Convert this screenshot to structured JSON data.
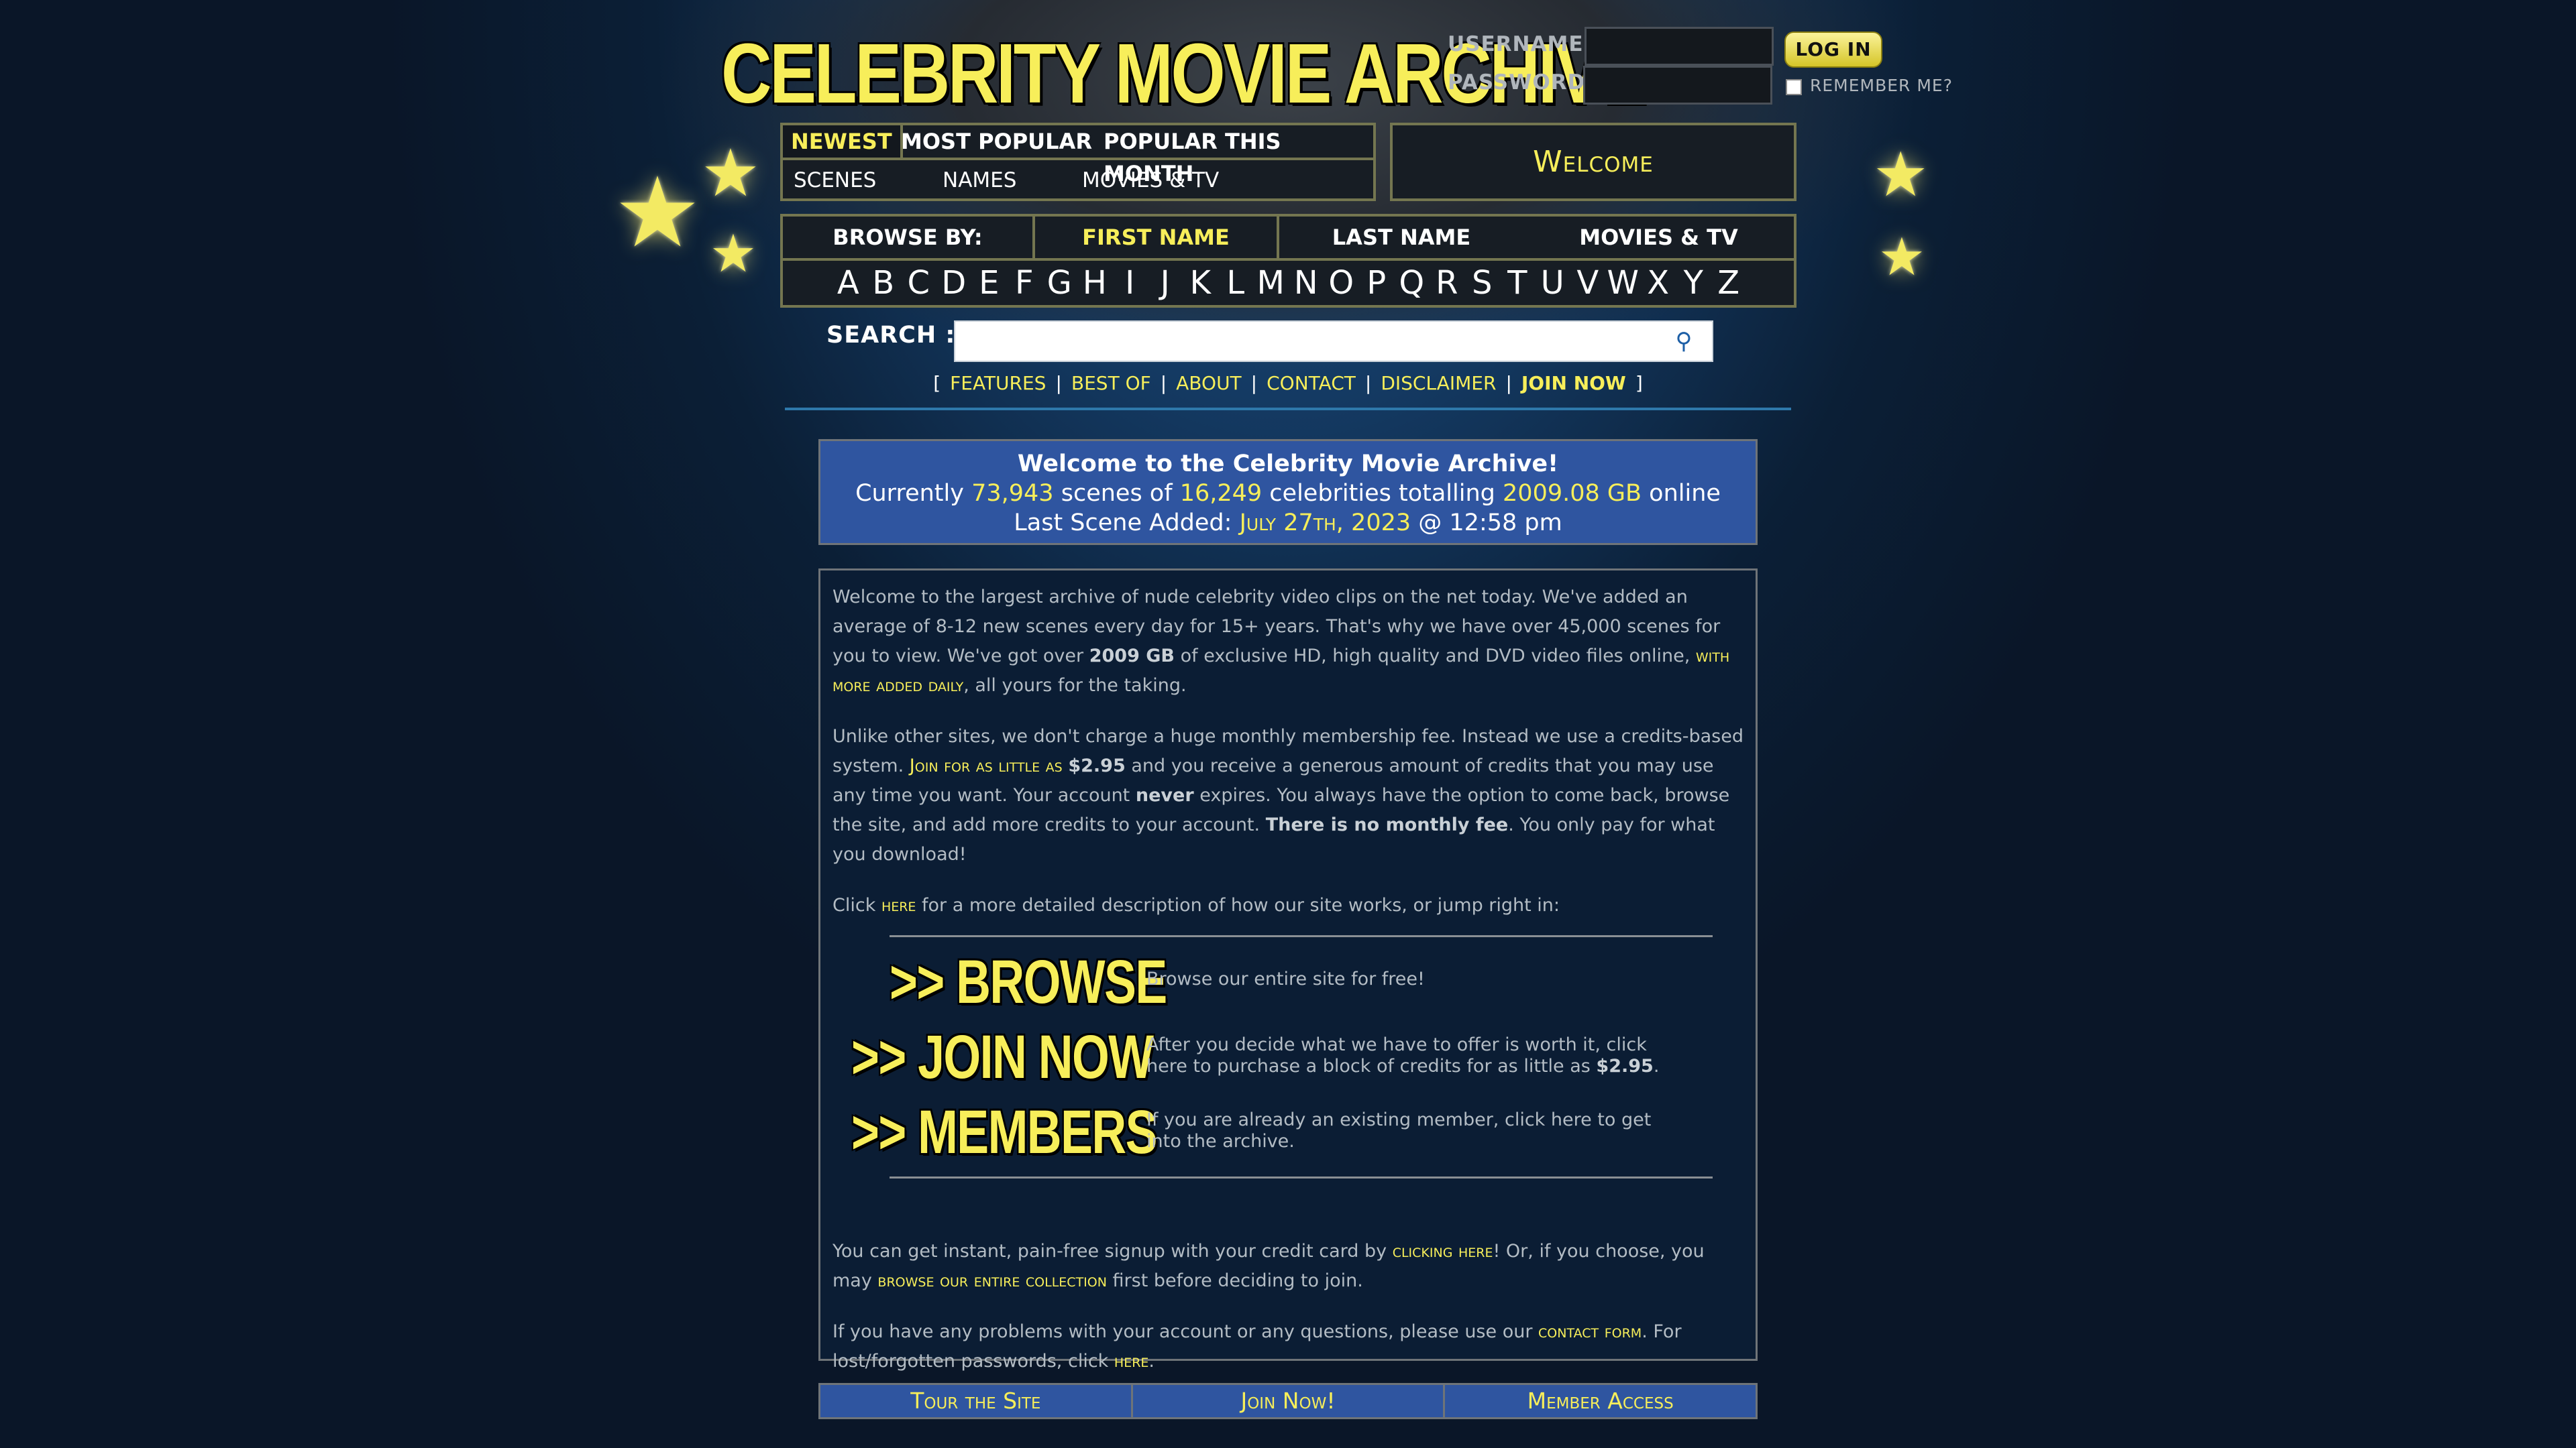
{
  "site": {
    "title": "CELEBRITY MOVIE ARCHIVE"
  },
  "login": {
    "username_label": "USERNAME:",
    "password_label": "PASSWORD:",
    "button_label": "LOG IN",
    "remember_label": "REMEMBER ME?"
  },
  "nav": {
    "tabs": [
      "NEWEST",
      "MOST POPULAR",
      "POPULAR THIS MONTH"
    ],
    "sublinks": [
      "SCENES",
      "NAMES",
      "MOVIES & TV"
    ]
  },
  "welcome": {
    "label": "Welcome"
  },
  "browse": {
    "label": "BROWSE BY:",
    "tabs": [
      "FIRST NAME",
      "LAST NAME",
      "MOVIES & TV"
    ],
    "letters": [
      "A",
      "B",
      "C",
      "D",
      "E",
      "F",
      "G",
      "H",
      "I",
      "J",
      "K",
      "L",
      "M",
      "N",
      "O",
      "P",
      "Q",
      "R",
      "S",
      "T",
      "U",
      "V",
      "W",
      "X",
      "Y",
      "Z"
    ]
  },
  "search": {
    "label": "SEARCH :",
    "placeholder": ""
  },
  "footer_links": {
    "open": "[",
    "close": "]",
    "items": [
      "FEATURES",
      "BEST OF",
      "ABOUT",
      "CONTACT",
      "DISCLAIMER",
      "JOIN NOW"
    ]
  },
  "stats": {
    "heading": "Welcome to the Celebrity Movie Archive!",
    "l2_prefix": "Currently",
    "scenes": "73,943",
    "l2_mid1": "scenes of",
    "celebrities": "16,249",
    "l2_mid2": "celebrities totalling",
    "size": "2009.08 GB",
    "l2_suffix": "online",
    "l3_prefix": "Last Scene Added:",
    "last_date": "July 27th, 2023",
    "last_time": "@ 12:58 pm"
  },
  "content": {
    "p1_a": "Welcome to the largest archive of nude celebrity video clips on the net today. We've added an average of 8-12 new scenes every day for 15+ years. That's why we have over 45,000 scenes for you to view. We've got over",
    "p1_bold": "2009 GB",
    "p1_b": "of exclusive HD, high quality and DVD video files online,",
    "p1_link": "with more added daily",
    "p1_c": ", all yours for the taking.",
    "p2_a": "Unlike other sites, we don't charge a huge monthly membership fee. Instead we use a credits-based system.",
    "p2_link": "Join for as little as",
    "p2_price": "$2.95",
    "p2_b": "and you receive a generous amount of credits that you may use any time you want. Your account",
    "p2_never": "never",
    "p2_c": "expires. You always have the option to come back, browse the site, and add more credits to your account.",
    "p2_bold": "There is no monthly fee",
    "p2_d": ". You only pay for what you download!",
    "p3_a": "Click",
    "p3_link": "here",
    "p3_b": "for a more detailed description of how our site works, or jump right in:",
    "cta": [
      {
        "label": ">> BROWSE",
        "desc": "Browse our entire site for free!"
      },
      {
        "label": ">> JOIN NOW",
        "desc": "After you decide what we have to offer is worth it, click here to purchase a block of credits for as little as",
        "price": "$2.95"
      },
      {
        "label": ">> MEMBERS",
        "desc": "If you are already an existing member, click here to get into the archive."
      }
    ],
    "p4_a": "You can get instant, pain-free signup with your credit card by",
    "p4_link1": "clicking here",
    "p4_b": "! Or, if you choose, you may",
    "p4_link2": "browse our entire collection",
    "p4_c": "first before deciding to join.",
    "p5_a": "If you have any problems with your account or any questions, please use our",
    "p5_link1": "contact form",
    "p5_b": ". For lost/forgotten passwords, click",
    "p5_link2": "here",
    "p5_c": "."
  },
  "bottom_bar": [
    "Tour the Site",
    "Join Now!",
    "Member Access"
  ],
  "colors": {
    "accent_yellow": "#f7ee5a",
    "panel_blue": "#2f55a0",
    "page_bg": "#0b1a2c"
  }
}
